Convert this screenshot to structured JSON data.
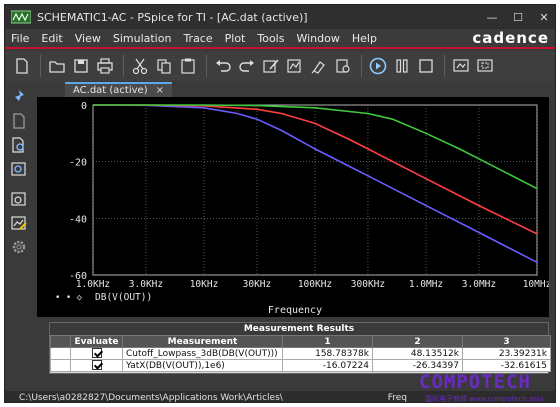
{
  "window": {
    "title": "SCHEMATIC1-AC - PSpice for TI - [AC.dat (active)]",
    "minimize": "—",
    "maximize": "☐",
    "close": "✕"
  },
  "menu": {
    "items": [
      "File",
      "Edit",
      "View",
      "Simulation",
      "Trace",
      "Plot",
      "Tools",
      "Window",
      "Help"
    ],
    "brand": "cadence"
  },
  "tab": {
    "label": "AC.dat (active)",
    "close": "×"
  },
  "chart_data": {
    "type": "line",
    "x_scale": "log",
    "xlabel": "Frequency",
    "ylabel": "",
    "xlim": [
      1000,
      10000000
    ],
    "ylim": [
      -60,
      0
    ],
    "x_ticks": [
      1000,
      3000,
      10000,
      30000,
      100000,
      300000,
      1000000,
      3000000,
      10000000
    ],
    "x_tick_labels": [
      "1.0KHz",
      "3.0KHz",
      "10KHz",
      "30KHz",
      "100KHz",
      "300KHz",
      "1.0MHz",
      "3.0MHz",
      "10MHz"
    ],
    "y_ticks": [
      0,
      -20,
      -40,
      -60
    ],
    "y_tick_labels": [
      "0",
      "-20",
      "-40",
      "-60"
    ],
    "grid": true,
    "legend": [
      {
        "marker": "• • ◇",
        "label": "DB(V(OUT))"
      }
    ],
    "series": [
      {
        "color": "#6a5cff",
        "x": [
          1000,
          3000,
          10000,
          20000,
          30000,
          50000,
          100000,
          200000,
          300000,
          1000000,
          3000000,
          10000000
        ],
        "y": [
          0,
          -0.1,
          -1.0,
          -3.0,
          -5.0,
          -9.0,
          -15.5,
          -21.5,
          -25.0,
          -35.5,
          -45.0,
          -55.5
        ]
      },
      {
        "color": "#ff4040",
        "x": [
          1000,
          3000,
          10000,
          30000,
          50000,
          100000,
          200000,
          300000,
          1000000,
          3000000,
          10000000
        ],
        "y": [
          0,
          0,
          -0.3,
          -1.5,
          -3.0,
          -6.5,
          -12.0,
          -15.5,
          -26.0,
          -35.5,
          -45.5
        ]
      },
      {
        "color": "#3ec83e",
        "x": [
          1000,
          10000,
          30000,
          100000,
          300000,
          500000,
          1000000,
          2000000,
          3000000,
          10000000
        ],
        "y": [
          0,
          0,
          -0.2,
          -1.0,
          -3.0,
          -5.0,
          -10.0,
          -15.5,
          -19.0,
          -29.5
        ]
      }
    ]
  },
  "measurements": {
    "title": "Measurement Results",
    "headers": [
      "Evaluate",
      "Measurement",
      "1",
      "2",
      "3"
    ],
    "rows": [
      {
        "evaluate": true,
        "name": "Cutoff_Lowpass_3dB(DB(V(OUT)))",
        "v1": "158.78378k",
        "v2": "48.13512k",
        "v3": "23.39231k"
      },
      {
        "evaluate": true,
        "name": "YatX(DB(V(OUT)),1e6)",
        "v1": "-16.07224",
        "v2": "-26.34397",
        "v3": "-32.61615"
      }
    ]
  },
  "status": {
    "path": "C:\\Users\\a0282827\\Documents\\Applications Work\\Articles\\",
    "right": "Freq"
  },
  "watermark": {
    "text": "COMPOTECH",
    "sub": "国际电子商情  www.compotech.asia"
  },
  "colors": {
    "accent": "#c8102e",
    "plot_bg": "#000000",
    "grid": "#8a8a8a",
    "tab_accent": "#5fa8e8"
  }
}
